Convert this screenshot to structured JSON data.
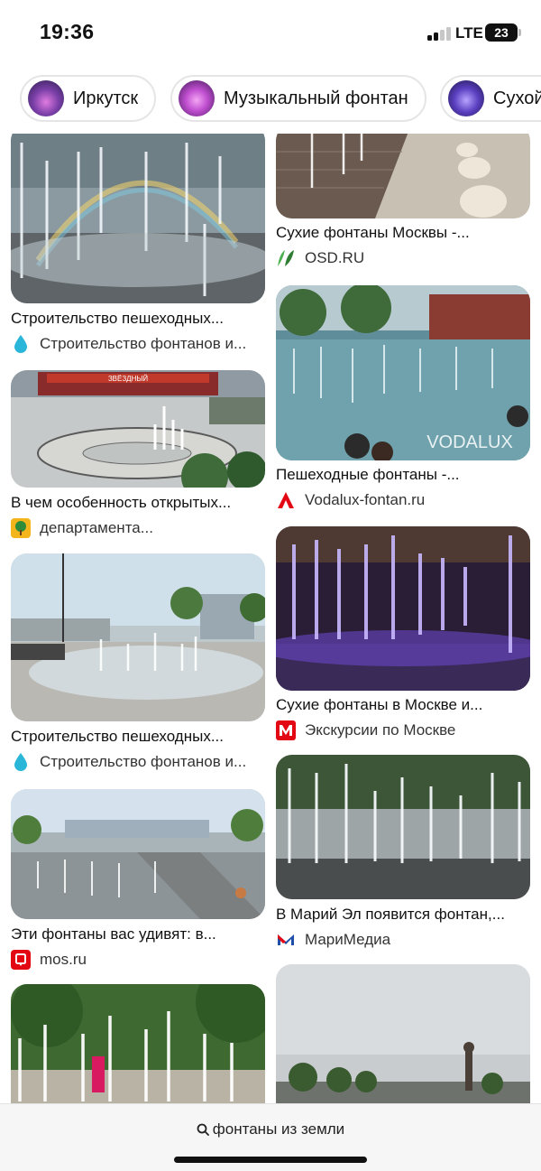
{
  "status_bar": {
    "time": "19:36",
    "network": "LTE",
    "battery": "23"
  },
  "chips": [
    {
      "label": "Иркутск"
    },
    {
      "label": "Музыкальный фонтан"
    },
    {
      "label": "Сухой"
    }
  ],
  "cards": [
    {
      "title": "Строительство пешеходных...",
      "source": "Строительство фонтанов и..."
    },
    {
      "title": "В чем особенность открытых...",
      "source": "департамента...",
      "sign": "ЗВЁЗДНЫЙ"
    },
    {
      "title": "Строительство пешеходных...",
      "source": "Строительство фонтанов и..."
    },
    {
      "title": "Эти фонтаны вас удивят: в...",
      "source": "mos.ru"
    },
    {
      "title": "",
      "source": ""
    },
    {
      "title": "Сухие фонтаны Москвы -...",
      "source": "OSD.RU"
    },
    {
      "title": "Пешеходные фонтаны -...",
      "source": "Vodalux-fontan.ru",
      "watermark": "VODALUX"
    },
    {
      "title": "Сухие фонтаны в Москве и...",
      "source": "Экскурсии по Москве"
    },
    {
      "title": "В Марий Эл появится фонтан,...",
      "source": "МариМедиа"
    },
    {
      "title": "",
      "source": ""
    }
  ],
  "search": {
    "query": "фонтаны из земли",
    "icon": "search-icon"
  },
  "colors": {
    "accent_red": "#e30613",
    "drop_blue": "#29b6d8",
    "osd_green": "#4caf50"
  }
}
